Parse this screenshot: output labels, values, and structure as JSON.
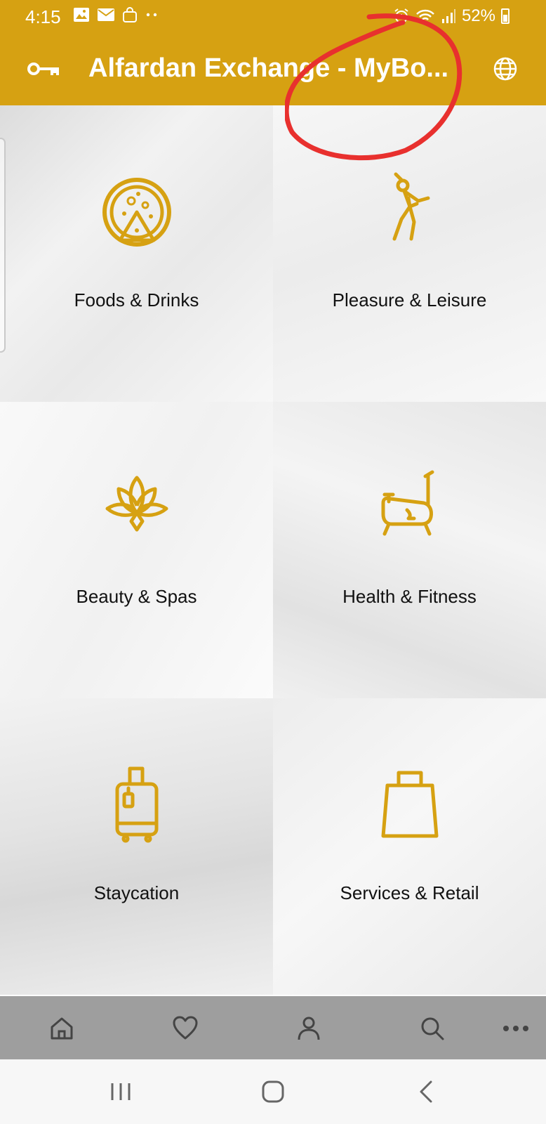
{
  "status_bar": {
    "time": "4:15",
    "battery": "52%",
    "notification_icons": [
      "image-icon",
      "mail-icon",
      "shopping-bag-icon",
      "more-dots-icon"
    ],
    "system_icons": [
      "alarm-icon",
      "wifi-icon",
      "signal-icon",
      "battery-icon"
    ]
  },
  "app_bar": {
    "title": "Alfardan Exchange - MyBo...",
    "left_icon": "key-icon",
    "right_icon": "globe-icon",
    "background": "#D6A112"
  },
  "categories": [
    {
      "label": "Foods & Drinks",
      "icon": "pizza-icon"
    },
    {
      "label": "Pleasure & Leisure",
      "icon": "golfer-icon"
    },
    {
      "label": "Beauty & Spas",
      "icon": "lotus-icon"
    },
    {
      "label": "Health & Fitness",
      "icon": "exercise-bike-icon"
    },
    {
      "label": "Staycation",
      "icon": "luggage-icon"
    },
    {
      "label": "Services & Retail",
      "icon": "shopping-bag-icon"
    }
  ],
  "bottom_nav": {
    "items": [
      "home-icon",
      "heart-icon",
      "profile-icon",
      "search-icon",
      "more-icon"
    ],
    "background": "#9E9E9E"
  },
  "system_nav": {
    "buttons": [
      "recents-icon",
      "home-button-icon",
      "back-icon"
    ]
  },
  "accent_color": "#D6A112",
  "annotation_color": "#E8302E"
}
